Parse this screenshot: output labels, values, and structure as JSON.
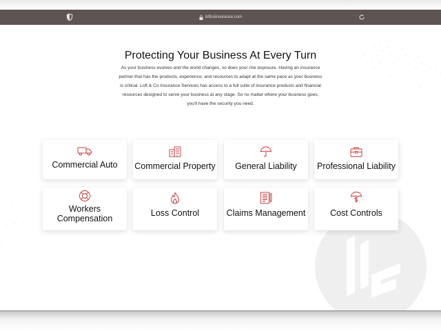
{
  "browser": {
    "url": "loftcoinsurance.com"
  },
  "main": {
    "headline": "Protecting Your Business At Every Turn",
    "intro": "As your business evolves and the world changes, so does your risk exposure. Having an insurance partner that has the products, experience, and resources to adapt at the same pace as your business is critical. Loft & Co Insurance Services has access to a full suite of insurance products and financial resources designed to serve your business at any stage. So no matter where your business goes, you'll have the security you need."
  },
  "colors": {
    "accent": "#c62f2f",
    "browser_bar": "#5e5452"
  },
  "cards": [
    {
      "label": "Commercial Auto",
      "icon": "truck-icon"
    },
    {
      "label": "Commercial Property",
      "icon": "building-icon"
    },
    {
      "label": "General Liability",
      "icon": "umbrella-icon"
    },
    {
      "label": "Professional Liability",
      "icon": "briefcase-icon"
    },
    {
      "label": "Workers\nCompensation",
      "icon": "lifebuoy-icon"
    },
    {
      "label": "Loss Control",
      "icon": "flame-icon"
    },
    {
      "label": "Claims Management",
      "icon": "document-icon"
    },
    {
      "label": "Cost Controls",
      "icon": "umbrella-dollar-icon"
    }
  ]
}
